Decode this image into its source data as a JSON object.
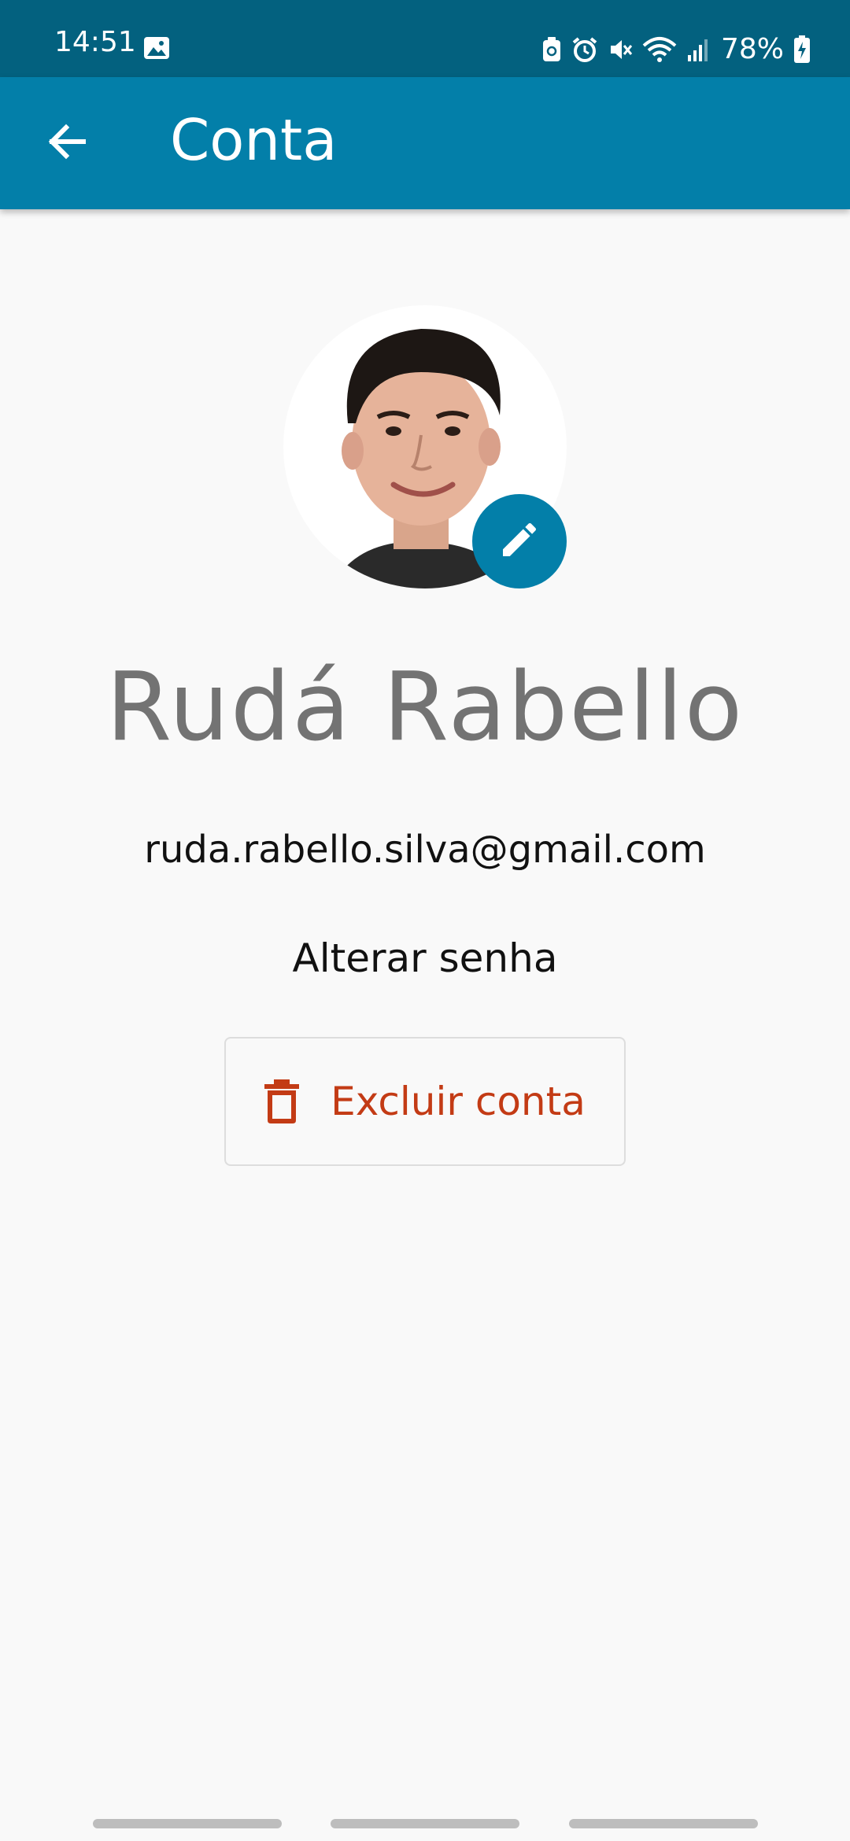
{
  "status_bar": {
    "time": "14:51",
    "battery_percent": "78%",
    "icons": [
      "gallery-icon",
      "battery-saver-icon",
      "alarm-icon",
      "mute-icon",
      "wifi-icon",
      "signal-icon",
      "battery-charging-icon"
    ]
  },
  "app_bar": {
    "title": "Conta",
    "back_icon": "arrow-left-icon"
  },
  "profile": {
    "name": "Rudá Rabello",
    "email": "ruda.rabello.silva@gmail.com",
    "edit_icon": "pencil-icon"
  },
  "actions": {
    "change_password_label": "Alterar senha",
    "delete_account_label": "Excluir conta",
    "delete_icon": "trash-icon"
  },
  "colors": {
    "status_bar": "#03617f",
    "primary": "#037fa9",
    "danger": "#c33b15",
    "name_text": "#737373",
    "background": "#f9f9f9"
  }
}
